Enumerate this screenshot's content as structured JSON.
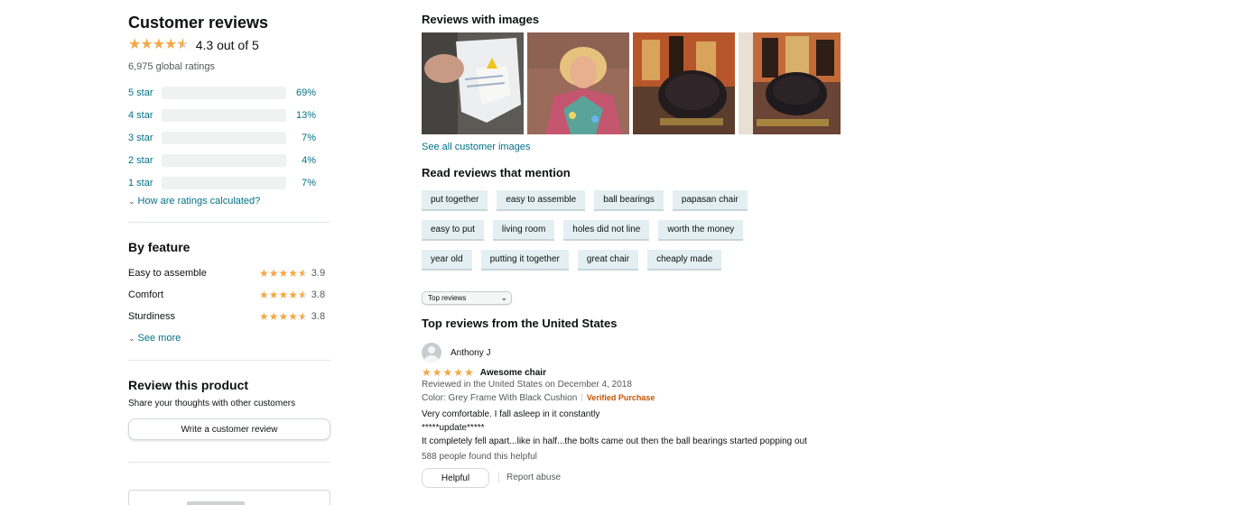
{
  "summary": {
    "title": "Customer reviews",
    "rating_value": 4.3,
    "rating_text": "4.3 out of 5",
    "global_ratings": "6,975 global ratings",
    "histogram": [
      {
        "label": "5 star",
        "percent": 69,
        "percent_text": "69%"
      },
      {
        "label": "4 star",
        "percent": 13,
        "percent_text": "13%"
      },
      {
        "label": "3 star",
        "percent": 7,
        "percent_text": "7%"
      },
      {
        "label": "2 star",
        "percent": 4,
        "percent_text": "4%"
      },
      {
        "label": "1 star",
        "percent": 7,
        "percent_text": "7%"
      }
    ],
    "how_calculated": "How are ratings calculated?"
  },
  "by_feature": {
    "title": "By feature",
    "items": [
      {
        "name": "Easy to assemble",
        "rating": 3.9,
        "value_text": "3.9"
      },
      {
        "name": "Comfort",
        "rating": 3.8,
        "value_text": "3.8"
      },
      {
        "name": "Sturdiness",
        "rating": 3.8,
        "value_text": "3.8"
      }
    ],
    "see_more": "See more"
  },
  "review_product": {
    "title": "Review this product",
    "subtitle": "Share your thoughts with other customers",
    "button": "Write a customer review"
  },
  "images": {
    "title": "Reviews with images",
    "see_all": "See all customer images",
    "thumbnails": [
      "warning-label-photo",
      "woman-selfie-photo",
      "papasan-chair-room-photo",
      "papasan-chair-room-photo-2"
    ]
  },
  "mentions": {
    "title": "Read reviews that mention",
    "chips": [
      "put together",
      "easy to assemble",
      "ball bearings",
      "papasan chair",
      "easy to put",
      "living room",
      "holes did not line",
      "worth the money",
      "year old",
      "putting it together",
      "great chair",
      "cheaply made"
    ]
  },
  "sort": {
    "selected": "Top reviews"
  },
  "top_reviews": {
    "title": "Top reviews from the United States",
    "reviews": [
      {
        "author": "Anthony J",
        "stars": 5,
        "title": "Awesome chair",
        "date": "Reviewed in the United States on December 4, 2018",
        "variant": "Color: Grey Frame With Black Cushion",
        "verified": "Verified Purchase",
        "body": [
          "Very comfortable. I fall asleep in it constantly",
          "*****update*****",
          "It completely fell apart...like in half...the bolts came out then the ball bearings started popping out"
        ],
        "helpful_count": "588 people found this helpful",
        "helpful_button": "Helpful",
        "report": "Report abuse"
      }
    ]
  },
  "colors": {
    "star": "#f3a847",
    "bar_fill": "#ffa41c",
    "link": "#007185",
    "verified": "#c45500",
    "chip_bg": "#e3eff2"
  }
}
